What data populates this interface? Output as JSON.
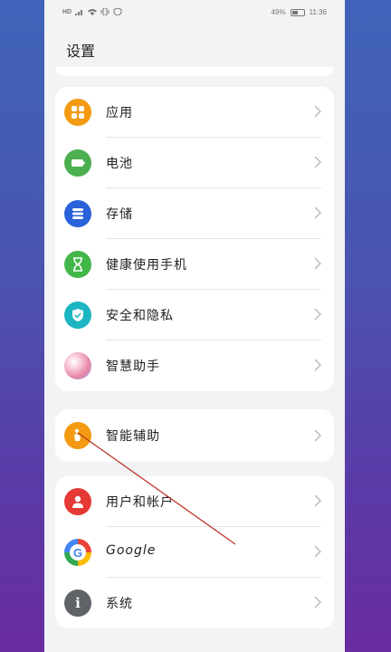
{
  "status_bar": {
    "left_icons": [
      "hd-icon",
      "signal-icon",
      "wifi-icon",
      "vibrate-icon",
      "shield-icon"
    ],
    "hd_text": "HD",
    "battery_percent": "49%",
    "time": "11:36"
  },
  "header": {
    "title": "设置"
  },
  "groups": [
    {
      "items": [
        {
          "name": "apps",
          "label": "应用",
          "icon": "apps-grid-icon",
          "color": "#f39a12"
        },
        {
          "name": "battery",
          "label": "电池",
          "icon": "battery-icon",
          "color": "#4caf50"
        },
        {
          "name": "storage",
          "label": "存储",
          "icon": "storage-icon",
          "color": "#2962d9"
        },
        {
          "name": "digital-wellbeing",
          "label": "健康使用手机",
          "icon": "hourglass-icon",
          "color": "#43b649"
        },
        {
          "name": "security-privacy",
          "label": "安全和隐私",
          "icon": "shield-icon",
          "color": "#1cb5c2"
        },
        {
          "name": "smart-assistant",
          "label": "智慧助手",
          "icon": "smart-assistant-icon",
          "color": "#f08a9a"
        }
      ]
    },
    {
      "items": [
        {
          "name": "accessibility",
          "label": "智能辅助",
          "icon": "hand-icon",
          "color": "#f39a12"
        }
      ]
    },
    {
      "items": [
        {
          "name": "users-accounts",
          "label": "用户和帐户",
          "icon": "user-icon",
          "color": "#e53935"
        },
        {
          "name": "google",
          "label": "Google",
          "icon": "google-icon",
          "color": "#ffffff"
        },
        {
          "name": "system",
          "label": "系统",
          "icon": "info-icon",
          "color": "#5f6368"
        }
      ]
    }
  ],
  "accent_colors": {
    "annotation_line": "#c0392b"
  }
}
